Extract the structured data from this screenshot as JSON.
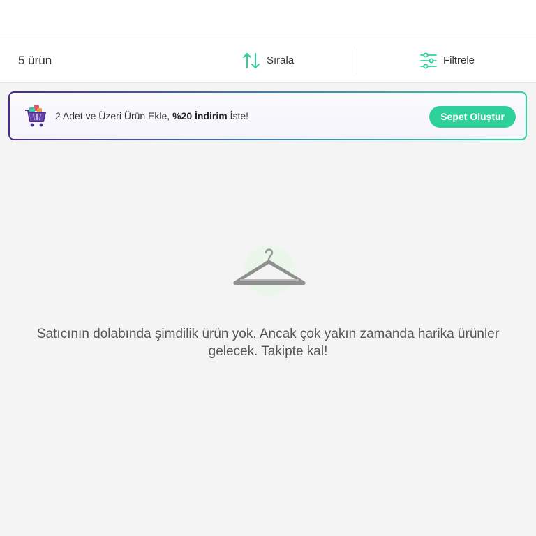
{
  "toolbar": {
    "product_count": "5 ürün",
    "sort_label": "Sırala",
    "filter_label": "Filtrele"
  },
  "banner": {
    "text_prefix": "2 Adet ve Üzeri Ürün Ekle, ",
    "text_bold": "%20 İndirim",
    "text_suffix": " İste!",
    "button_label": "Sepet Oluştur"
  },
  "empty_state": {
    "message": "Satıcının dolabında şimdilik ürün yok. Ancak çok yakın zamanda harika ürünler gelecek. Takipte kal!"
  },
  "icons": {
    "sort": "sort-arrows-icon",
    "filter": "filter-sliders-icon",
    "banner": "shopping-basket-icon",
    "empty": "hanger-icon"
  },
  "colors": {
    "accent_green": "#2fd19b",
    "banner_purple": "#4a2b86",
    "background": "#f4f4f4"
  }
}
